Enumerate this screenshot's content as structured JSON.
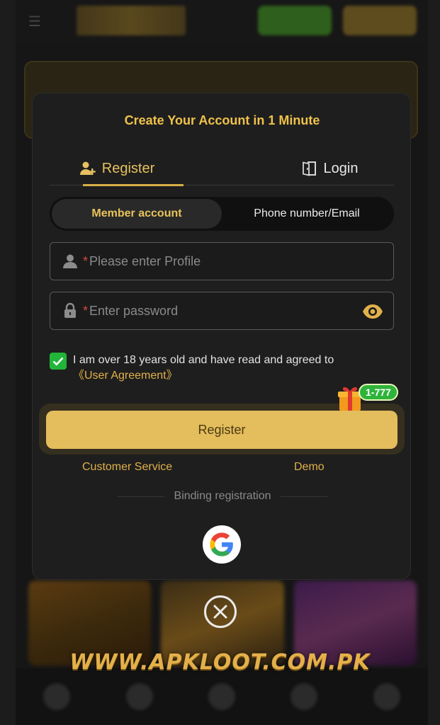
{
  "modal": {
    "title": "Create Your Account in 1 Minute",
    "tabs": [
      {
        "label": "Register",
        "icon": "add-user-icon",
        "active": true
      },
      {
        "label": "Login",
        "icon": "login-door-icon",
        "active": false
      }
    ],
    "segments": [
      {
        "label": "Member account",
        "active": true
      },
      {
        "label": "Phone number/Email",
        "active": false
      }
    ],
    "profile_field": {
      "required_mark": "*",
      "placeholder": "Please enter Profile",
      "icon": "user-icon"
    },
    "password_field": {
      "required_mark": "*",
      "placeholder": "Enter password",
      "icon": "lock-icon",
      "toggle_icon": "eye-icon"
    },
    "agreement": {
      "checked": true,
      "text": "I am over 18 years old and have read and agreed to",
      "link": "《User Agreement》"
    },
    "bonus_badge": "1-777",
    "register_button": "Register",
    "customer_service": "Customer Service",
    "demo": "Demo",
    "binding_label": "Binding registration",
    "social_login": "google-icon"
  },
  "close_icon": "close-icon",
  "watermark": "WWW.APKLOOT.COM.PK",
  "colors": {
    "accent_gold": "#f0c24a",
    "button_gold": "#e4bd5c",
    "check_green": "#22b53a",
    "required_red": "#d9463b",
    "modal_bg": "#1e1e1e"
  }
}
